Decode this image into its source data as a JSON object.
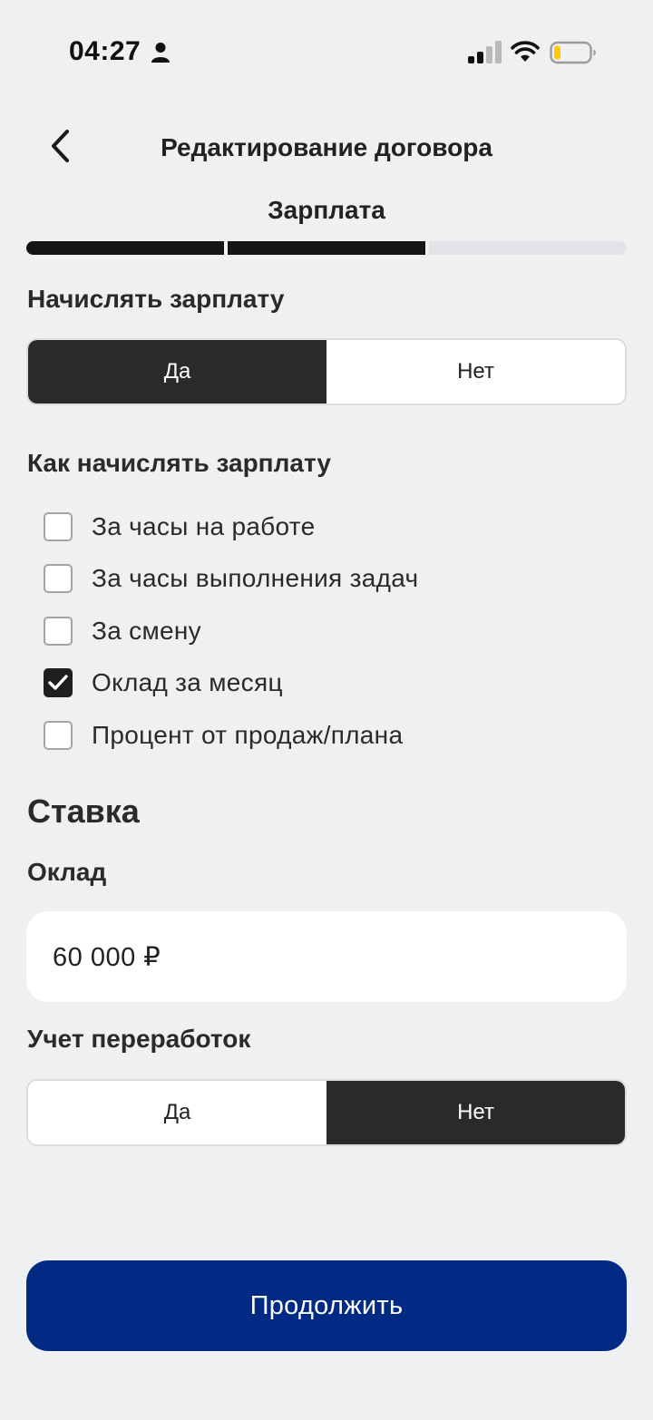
{
  "status_bar": {
    "time": "04:27"
  },
  "header": {
    "title": "Редактирование договора",
    "step_title": "Зарплата"
  },
  "progress": {
    "total_steps": 3,
    "completed_steps": 2
  },
  "accrue_salary": {
    "label": "Начислять зарплату",
    "options": [
      "Да",
      "Нет"
    ],
    "selected": "Да"
  },
  "salary_method": {
    "label": "Как начислять зарплату",
    "options": [
      {
        "label": "За часы на работе",
        "checked": false
      },
      {
        "label": "За часы выполнения задач",
        "checked": false
      },
      {
        "label": "За смену",
        "checked": false
      },
      {
        "label": "Оклад за месяц",
        "checked": true
      },
      {
        "label": "Процент от продаж/плана",
        "checked": false
      }
    ]
  },
  "rate": {
    "title": "Ставка",
    "salary_label": "Оклад",
    "salary_value": "60 000 ₽",
    "overtime_label": "Учет переработок",
    "overtime_options": [
      "Да",
      "Нет"
    ],
    "overtime_selected": "Нет"
  },
  "continue_button": {
    "label": "Продолжить"
  },
  "colors": {
    "background": "#eff0f2",
    "primary": "#002a84",
    "dark": "#2a2a2a"
  }
}
